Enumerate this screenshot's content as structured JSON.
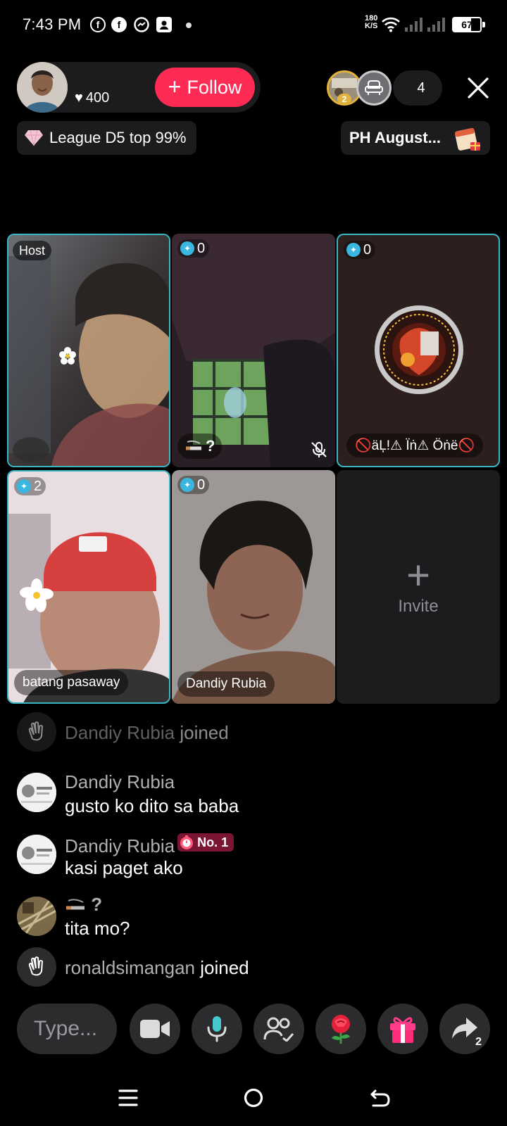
{
  "status_bar": {
    "time": "7:43 PM",
    "speed_value": "180",
    "speed_unit": "K/S",
    "battery": "67",
    "battery_level": 0.67,
    "notification_icons": [
      "facebook-icon",
      "facebook-icon",
      "messenger-icon",
      "app-icon"
    ]
  },
  "header": {
    "likes": "400",
    "follow_label": "Follow",
    "viewer_count": "4",
    "viewer_badge": "2",
    "league_text": "League D5 top 99%",
    "event_text": "PH August..."
  },
  "grid": {
    "host_label": "Host",
    "guests": [
      {
        "count": "0",
        "name": "? "
      },
      {
        "count": "0",
        "name": "🚫äĻ!⚠ Ïṅ⚠ Öṅë🚫"
      },
      {
        "count": "2",
        "name": "batang pasaway"
      },
      {
        "count": "0",
        "name": "Dandiy Rubia"
      }
    ],
    "guest1_name": "?",
    "invite_label": "Invite"
  },
  "chat": [
    {
      "user": "Dandiy Rubia",
      "action": "joined"
    },
    {
      "user": "Dandiy Rubia",
      "message": "gusto ko dito sa baba"
    },
    {
      "user": "Dandiy Rubia",
      "badge": "No. 1",
      "message": "kasi paget ako"
    },
    {
      "user": "?",
      "message": "tita mo?"
    },
    {
      "user": "ronaldsimangan",
      "action": "joined"
    }
  ],
  "bottom_bar": {
    "type_placeholder": "Type...",
    "share_count": "2",
    "buttons": [
      "video-icon",
      "mic-icon",
      "guests-icon",
      "rose-gift-icon",
      "gift-icon",
      "share-icon"
    ]
  },
  "colors": {
    "accent": "#fe2c55",
    "active_border": "#3ab7c6",
    "pill_bg": "#1c1c1e"
  }
}
